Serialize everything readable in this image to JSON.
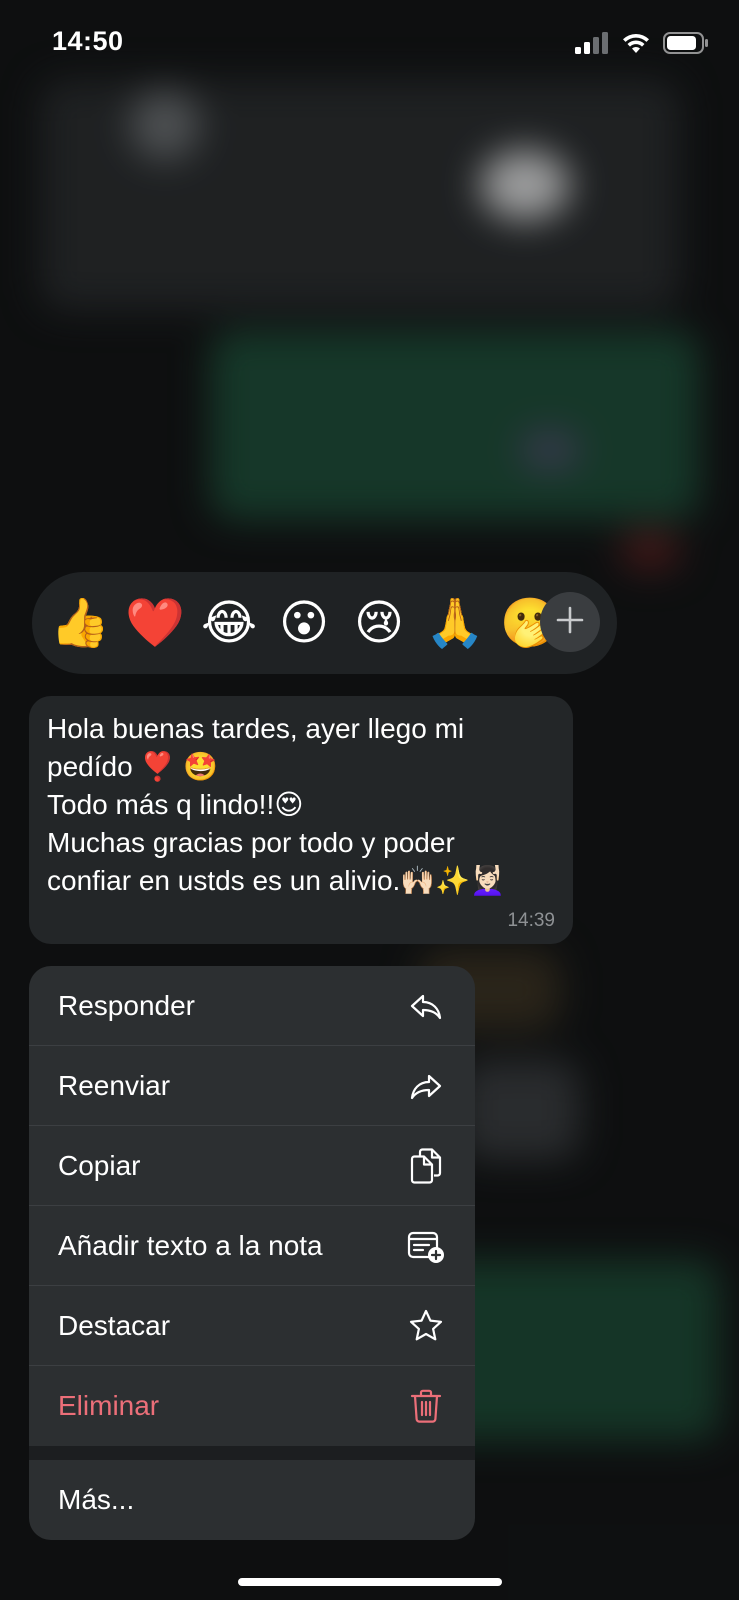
{
  "status_bar": {
    "time": "14:50",
    "icons": [
      "signal-icon",
      "wifi-icon",
      "battery-icon"
    ]
  },
  "reactions": {
    "emojis": [
      "👍",
      "❤️",
      "😂",
      "😮",
      "😢",
      "🙏",
      "🫢"
    ],
    "more_icon": "plus-icon"
  },
  "message": {
    "lines": [
      "Hola buenas tardes, ayer llego mi",
      "pedído ❣️ 🤩",
      "Todo más q lindo!!😍",
      "Muchas gracias por todo y poder",
      "confiar en ustds es un alivio.🙌🏻✨💆🏻‍♀️"
    ],
    "time": "14:39"
  },
  "menu": {
    "items": [
      {
        "label": "Responder",
        "icon": "reply-icon"
      },
      {
        "label": "Reenviar",
        "icon": "forward-icon"
      },
      {
        "label": "Copiar",
        "icon": "copy-icon"
      },
      {
        "label": "Añadir texto a la nota",
        "icon": "add-note-icon"
      },
      {
        "label": "Destacar",
        "icon": "star-icon"
      },
      {
        "label": "Eliminar",
        "icon": "trash-icon"
      }
    ],
    "more_label": "Más..."
  },
  "colors": {
    "danger": "#ec6f79",
    "menu_bg": "#2c2f31",
    "bubble_bg": "#232628"
  }
}
